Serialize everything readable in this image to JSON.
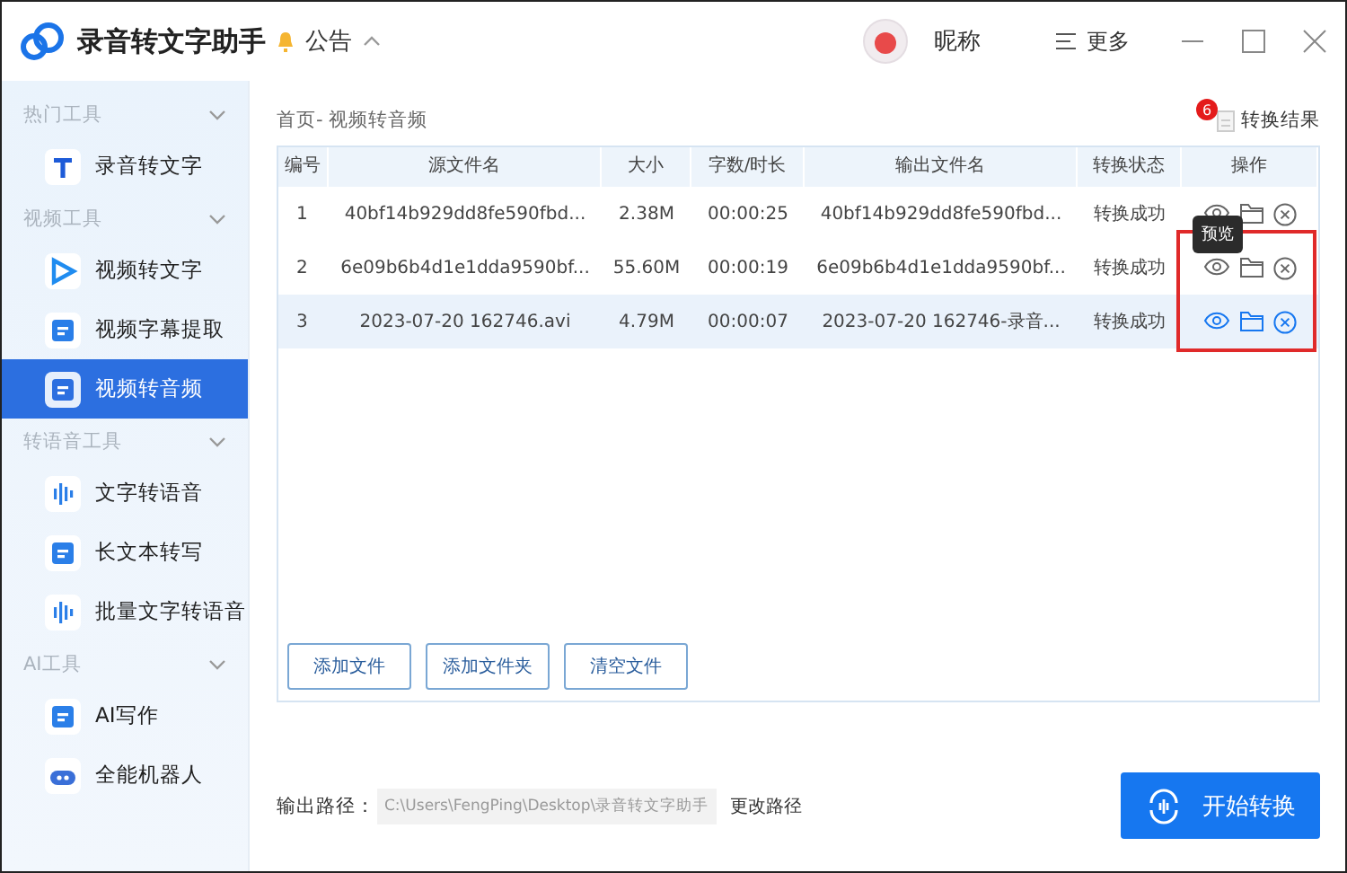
{
  "app": {
    "title": "录音转文字助手",
    "notice": "公告",
    "user": "昵称",
    "more": "更多"
  },
  "sidebar": {
    "groups": [
      {
        "label": "热门工具",
        "expanded": true,
        "items": [
          {
            "label": "录音转文字",
            "selected": false
          }
        ]
      },
      {
        "label": "视频工具",
        "expanded": true,
        "items": [
          {
            "label": "视频转文字",
            "selected": false
          },
          {
            "label": "视频字幕提取",
            "selected": false
          },
          {
            "label": "视频转音频",
            "selected": true
          }
        ]
      },
      {
        "label": "转语音工具",
        "expanded": true,
        "items": [
          {
            "label": "文字转语音",
            "selected": false
          },
          {
            "label": "长文本转写",
            "selected": false
          },
          {
            "label": "批量文字转语音",
            "selected": false
          }
        ]
      },
      {
        "label": "AI工具",
        "expanded": true,
        "items": [
          {
            "label": "AI写作",
            "selected": false
          },
          {
            "label": "全能机器人",
            "selected": false
          }
        ]
      }
    ]
  },
  "breadcrumb": "首页- 视频转音频",
  "results": {
    "label": "转换结果",
    "count": "6"
  },
  "table": {
    "columns": [
      "编号",
      "源文件名",
      "大小",
      "字数/时长",
      "输出文件名",
      "转换状态",
      "操作"
    ],
    "rows": [
      {
        "cells": [
          "1",
          "40bf14b929dd8fe590fbd...",
          "2.38M",
          "00:00:25",
          "40bf14b929dd8fe590fbd...",
          "转换成功"
        ],
        "selected": false
      },
      {
        "cells": [
          "2",
          "6e09b6b4d1e1dda9590bf...",
          "55.60M",
          "00:00:19",
          "6e09b6b4d1e1dda9590bf...",
          "转换成功"
        ],
        "selected": false
      },
      {
        "cells": [
          "3",
          "2023-07-20 162746.avi",
          "4.79M",
          "00:00:07",
          "2023-07-20 162746-录音...",
          "转换成功"
        ],
        "selected": true
      }
    ]
  },
  "tooltip": {
    "text": "预览"
  },
  "buttons": [
    "添加文件",
    "添加文件夹",
    "清空文件"
  ],
  "output": {
    "label": "输出路径：",
    "path": "C:\\Users\\FengPing\\Desktop\\录音转文字助手",
    "change": "更改路径"
  },
  "start_button": "开始转换"
}
